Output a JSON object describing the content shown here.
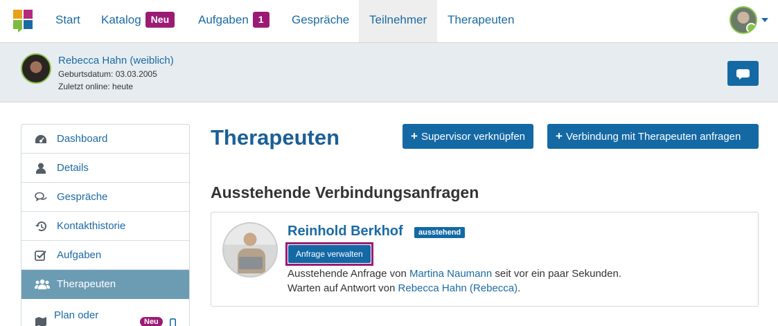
{
  "nav": {
    "items": [
      {
        "label": "Start"
      },
      {
        "label": "Katalog",
        "badge": "Neu"
      },
      {
        "label": "Aufgaben",
        "badge": "1"
      },
      {
        "label": "Gespräche"
      },
      {
        "label": "Teilnehmer",
        "active": true
      },
      {
        "label": "Therapeuten"
      }
    ]
  },
  "patient": {
    "name": "Rebecca Hahn (weiblich)",
    "birthdate": "Geburtsdatum: 03.03.2005",
    "last_online": "Zuletzt online: heute"
  },
  "sidebar": {
    "items": [
      {
        "label": "Dashboard",
        "icon": "dashboard-icon"
      },
      {
        "label": "Details",
        "icon": "user-icon"
      },
      {
        "label": "Gespräche",
        "icon": "comments-icon"
      },
      {
        "label": "Kontakthistorie",
        "icon": "history-icon"
      },
      {
        "label": "Aufgaben",
        "icon": "checkbox-icon"
      },
      {
        "label": "Therapeuten",
        "icon": "group-icon",
        "active": true
      },
      {
        "label": "Plan oder",
        "icon": "map-icon",
        "badge": "Neu"
      }
    ]
  },
  "main": {
    "title": "Therapeuten",
    "btn_supervisor": "Supervisor verknüpfen",
    "btn_connect": "Verbindung mit Therapeuten anfragen",
    "section_title": "Ausstehende Verbindungsanfragen",
    "request": {
      "name": "Reinhold Berkhof",
      "status": "ausstehend",
      "manage_label": "Anfrage verwalten",
      "line1_prefix": "Ausstehende Anfrage von ",
      "line1_link": "Martina Naumann",
      "line1_suffix": " seit vor ein paar Sekunden.",
      "line2_prefix": "Warten auf Antwort von ",
      "line2_link": "Rebecca Hahn (Rebecca)",
      "line2_suffix": "."
    }
  },
  "colors": {
    "primary": "#1469a5",
    "accent_purple": "#9b1b74",
    "sidebar_active": "#6c9cb4",
    "online_green": "#8bc34a"
  }
}
